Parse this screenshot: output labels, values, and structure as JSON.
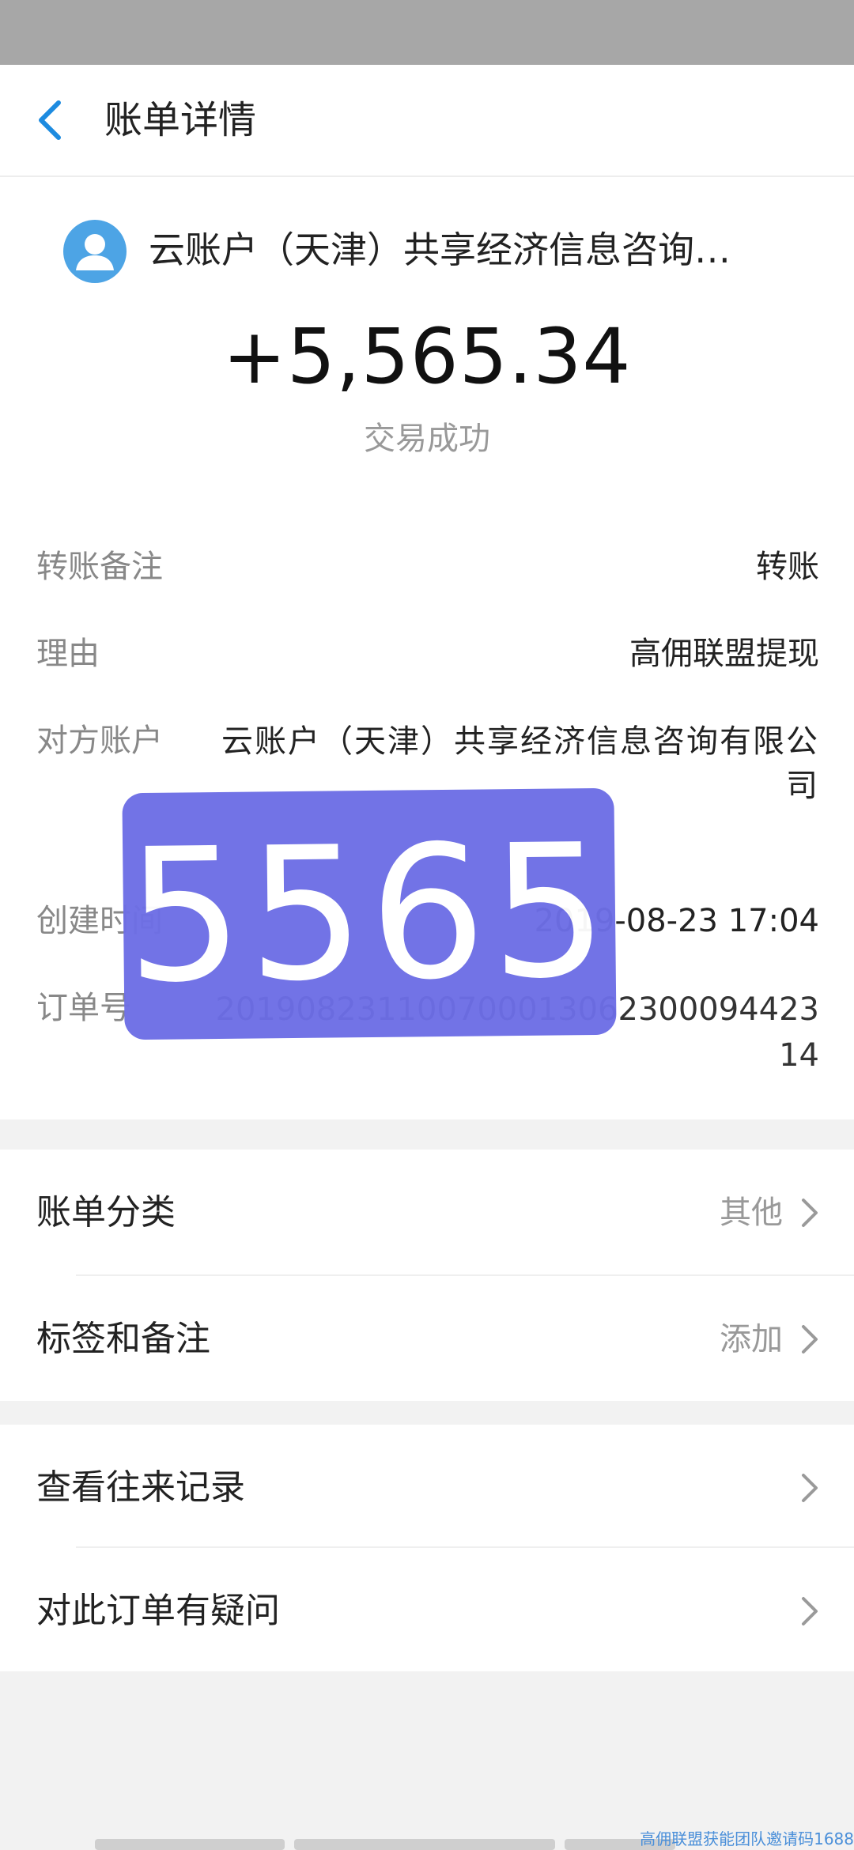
{
  "nav": {
    "title": "账单详情"
  },
  "payee": {
    "name": "云账户（天津）共享经济信息咨询…"
  },
  "amount": "+5,565.34",
  "status": "交易成功",
  "details": [
    {
      "label": "转账备注",
      "value": "转账"
    },
    {
      "label": "理由",
      "value": "高佣联盟提现"
    },
    {
      "label": "对方账户",
      "value": "云账户（天津）共享经济信息咨询有限公司"
    },
    {
      "label": "创建时间",
      "value": "2019-08-23 17:04"
    },
    {
      "label": "订单号",
      "value": "20190823110070001306230009442314"
    }
  ],
  "overlay": {
    "text": "5565"
  },
  "list_group_1": [
    {
      "label": "账单分类",
      "value": "其他"
    },
    {
      "label": "标签和备注",
      "value": "添加"
    }
  ],
  "list_group_2": [
    {
      "label": "查看往来记录"
    },
    {
      "label": "对此订单有疑问"
    }
  ],
  "watermark": "高佣联盟获能团队邀请码1688",
  "colors": {
    "accent": "#1d8be0",
    "overlay": "#6d6ee6",
    "avatar": "#4da4e5"
  },
  "icons": [
    "back-icon",
    "avatar-icon",
    "chevron-right-icon"
  ]
}
